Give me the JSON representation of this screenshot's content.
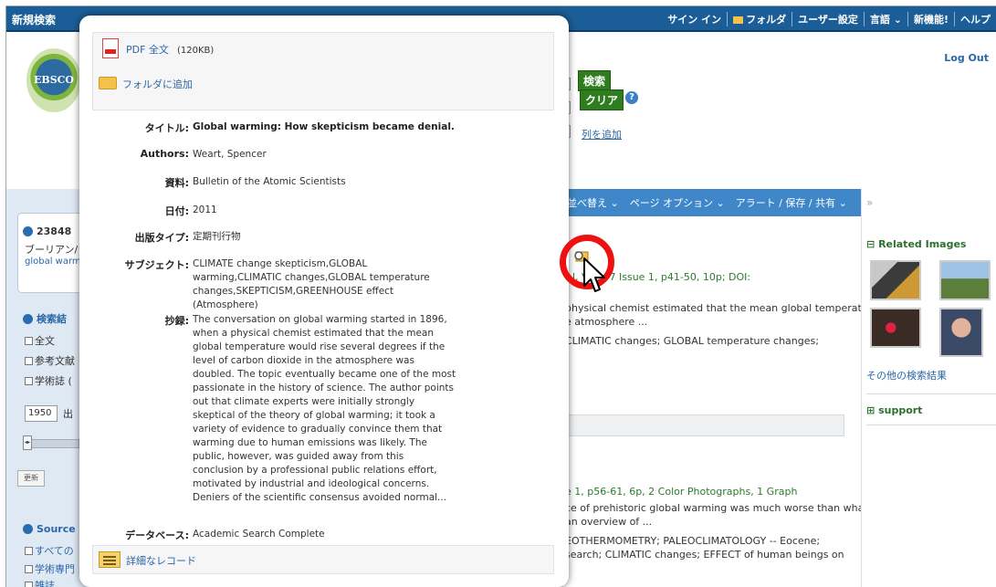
{
  "topbar": {
    "new_search": "新規検索",
    "links": [
      "サイン イン",
      "フォルダ",
      "ユーザー設定",
      "言語 ⌄",
      "新機能!",
      "ヘルプ"
    ]
  },
  "header": {
    "logo_text": "EBSCO",
    "logout": "Log Out",
    "search_button": "検索",
    "clear_button": "クリア",
    "add_column": "列を追加"
  },
  "toolbar": {
    "items": [
      "並べ替え ⌄",
      "ページ オプション ⌄",
      "アラート / 保存 / 共有 ⌄"
    ]
  },
  "sidebar": {
    "result_count": "23848",
    "boolean_label": "ブーリアン/",
    "query_fragment": "global warm",
    "refine_label": "検索結",
    "checkboxes": [
      "全文",
      "参考文献",
      "学術誌 ("
    ],
    "year_from": "1950",
    "year_label": "出",
    "update_button": "更新",
    "source_label": "Source",
    "source_items": [
      "すべての",
      "学術専門",
      "雑誌"
    ]
  },
  "right": {
    "collapse": "»",
    "related_images": "Related Images",
    "more_results": "その他の検索結果",
    "support": "support"
  },
  "results": {
    "r1_meta": "l, Vol. 67 Issue 1, p41-50, 10p; DOI:",
    "r1_abstract1": "physical chemist estimated that the mean global temperature",
    "r1_abstract2": "e atmosphere ...",
    "r1_subjects": "CLIMATIC changes; GLOBAL temperature changes;",
    "r2_meta": "e 1, p56-61, 6p, 2 Color Photographs, 1 Graph",
    "r2_abstract1": "ce of prehistoric global warming was much worse than what",
    "r2_abstract2": "an overview of ...",
    "r2_subjects1": "EOTHERMOMETRY; PALEOCLIMATOLOGY -- Eocene;",
    "r2_subjects2": "search; CLIMATIC changes; EFFECT of human beings on"
  },
  "popup": {
    "pdf_link": "PDF 全文",
    "pdf_size": "(120KB)",
    "folder_link": "フォルダに追加",
    "fields": {
      "title_label": "タイトル:",
      "title_value": "Global warming: How skepticism became denial.",
      "authors_label": "Authors:",
      "authors_value": "Weart, Spencer",
      "source_label": "資料:",
      "source_value": "Bulletin of the Atomic Scientists",
      "date_label": "日付:",
      "date_value": "2011",
      "pubtype_label": "出版タイプ:",
      "pubtype_value": "定期刊行物",
      "subject_label": "サブジェクト:",
      "subject_value": "CLIMATE change skepticism,GLOBAL warming,CLIMATIC changes,GLOBAL temperature changes,SKEPTICISM,GREENHOUSE effect (Atmosphere)",
      "abstract_label": "抄録:",
      "abstract_value": "The conversation on global warming started in 1896, when a physical chemist estimated that the mean global temperature would rise several degrees if the level of carbon dioxide in the atmosphere was doubled. The topic eventually became one of the most passionate in the history of science. The author points out that climate experts were initially strongly skeptical of the theory of global warming; it took a variety of evidence to gradually convince them that warming due to human emissions was likely. The public, however, was guided away from this conclusion by a professional public relations effort, motivated by industrial and ideological concerns. Deniers of the scientific consensus avoided normal...",
      "database_label": "データベース:",
      "database_value": "Academic Search Complete"
    },
    "detail_link": "詳細なレコード"
  }
}
